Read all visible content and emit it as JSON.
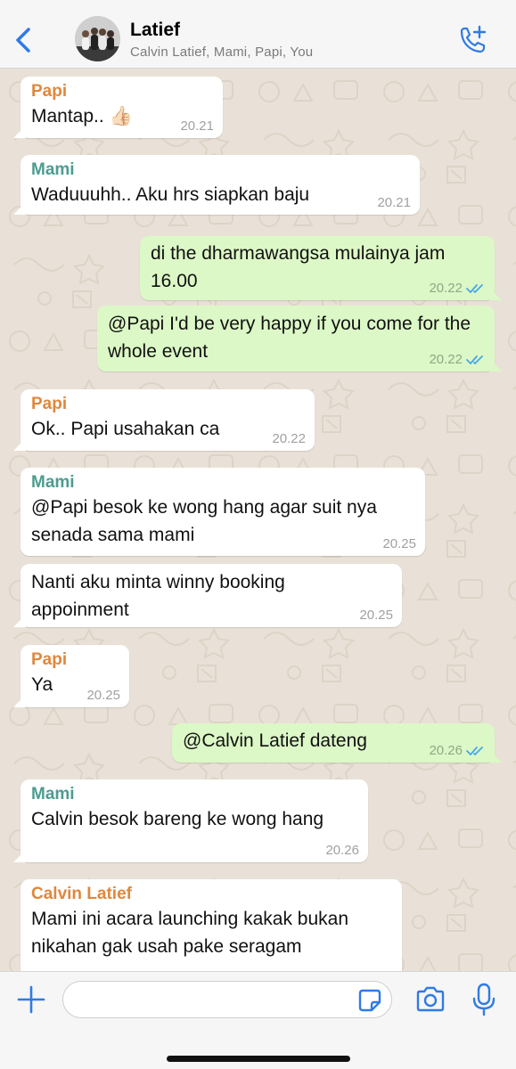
{
  "header": {
    "title": "Latief",
    "subtitle": "Calvin Latief, Mami, Papi, You",
    "back_icon": "chevron-left-icon",
    "call_icon": "add-call-icon",
    "accent": "#2f7be5"
  },
  "colors": {
    "Papi": "#e0873c",
    "Mami": "#4d9c90",
    "Calvin Latief": "#e0873c",
    "incoming_bubble": "#ffffff",
    "outgoing_bubble": "#dcf8c6",
    "read_ticks": "#4aa6e8"
  },
  "messages": [
    {
      "dir": "in",
      "sender": "Papi",
      "text": "Mantap.. 👍🏻",
      "time": "20.21"
    },
    {
      "dir": "in",
      "sender": "Mami",
      "text": "Waduuuhh.. Aku hrs siapkan baju",
      "time": "20.21"
    },
    {
      "dir": "out",
      "text": "di the dharmawangsa mulainya jam 16.00",
      "time": "20.22",
      "status": "read"
    },
    {
      "dir": "out",
      "text": "@Papi I'd be very happy if you come for the whole event",
      "time": "20.22",
      "status": "read"
    },
    {
      "dir": "in",
      "sender": "Papi",
      "text": "Ok.. Papi usahakan ca",
      "time": "20.22"
    },
    {
      "dir": "in",
      "sender": "Mami",
      "text": "@Papi besok ke wong hang agar suit nya senada sama mami",
      "time": "20.25"
    },
    {
      "dir": "in",
      "text": "Nanti aku minta winny booking appoinment",
      "time": "20.25"
    },
    {
      "dir": "in",
      "sender": "Papi",
      "text": "Ya",
      "time": "20.25"
    },
    {
      "dir": "out",
      "text": "@Calvin Latief dateng",
      "time": "20.26",
      "status": "read"
    },
    {
      "dir": "in",
      "sender": "Mami",
      "text": "Calvin besok bareng ke wong hang",
      "time": "20.26"
    },
    {
      "dir": "in",
      "sender": "Calvin Latief",
      "text": "Mami ini acara launching kakak bukan nikahan gak usah pake seragam",
      "time": ""
    }
  ],
  "input": {
    "value": "",
    "placeholder": "",
    "plus_icon": "plus-icon",
    "sticker_icon": "sticker-icon",
    "camera_icon": "camera-icon",
    "mic_icon": "microphone-icon"
  }
}
